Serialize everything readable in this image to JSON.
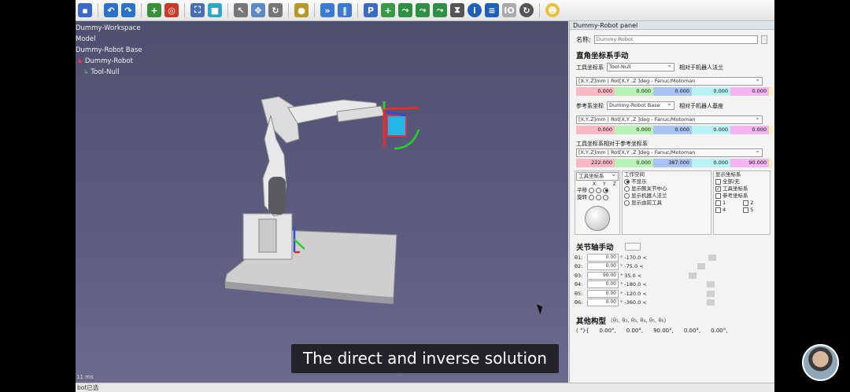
{
  "tree": {
    "workspace": "Dummy-Workspace",
    "model": "Model",
    "base": "Dummy-Robot Base",
    "robot": "Dummy-Robot",
    "tool": "Tool-Null"
  },
  "viewport": {
    "fps": "11 ms",
    "status": "bot已选"
  },
  "panel": {
    "title": "Dummy-Robot panel",
    "name_label": "名称:",
    "name_value": "Dummy-Robot",
    "cartesian_header": "直角坐标系手动",
    "tool_frame_label": "工具坐标系",
    "tool_frame_value": "Tool-Null",
    "tool_frame_rel": "相对于机器人法兰",
    "format_combo": "[X,Y,Z]mm | Rot[X,Y ,Z ]deg - Fanuc/Motoman",
    "tool_values": [
      "0.000",
      "0.000",
      "0.000",
      "0.000",
      "0.000"
    ],
    "ref_frame_label": "参考系坐标",
    "ref_frame_value": "Dummy-Robot Base",
    "ref_frame_rel": "相对于机器人基座",
    "ref_values": [
      "0.000",
      "0.000",
      "0.000",
      "0.000",
      "0.000"
    ],
    "tool_rel_ref_label": "工具坐标系相对于参考坐标系",
    "pose_values": [
      "222.000",
      "0.000",
      "387.000",
      "0.000",
      "90.000"
    ],
    "tool_frame_combo": "工具坐标系",
    "xyz_header": [
      "X",
      "Y",
      "Z"
    ],
    "translate_label": "平移",
    "rotate_label": "旋转",
    "workspace_title": "工作空间",
    "workspace_opts": [
      "不显示",
      "显示腕关节中心",
      "显示机器人法兰",
      "显示由前工具"
    ],
    "display_title": "显示坐标系",
    "display_opts": [
      "全部/无",
      "工具坐标系",
      "参考坐标系"
    ],
    "display_small": [
      "1",
      "2",
      "4",
      "5"
    ],
    "joint_header": "关节轴手动",
    "joints": [
      {
        "label": "θ1:",
        "value": "0.00",
        "limit": "° -170.0 <"
      },
      {
        "label": "θ2:",
        "value": "0.00",
        "limit": "° -75.0 <"
      },
      {
        "label": "θ3:",
        "value": "90.00",
        "limit": "° 35.0 <"
      },
      {
        "label": "θ4:",
        "value": "0.00",
        "limit": "° -180.0 <"
      },
      {
        "label": "θ5:",
        "value": "0.00",
        "limit": "° -120.0 <"
      },
      {
        "label": "θ6:",
        "value": "0.00",
        "limit": "° -360.0 <"
      }
    ],
    "other_config_header": "其他构型",
    "other_config_sub": "(θ₁, θ₂, θ₃, θ₄, θ₅, θ₆)",
    "config_values": [
      "( °)-[",
      "0.00°,",
      "0.00°,",
      "90.00°,",
      "0.00°,",
      "0.00°,"
    ]
  },
  "caption": "The direct and inverse solution"
}
